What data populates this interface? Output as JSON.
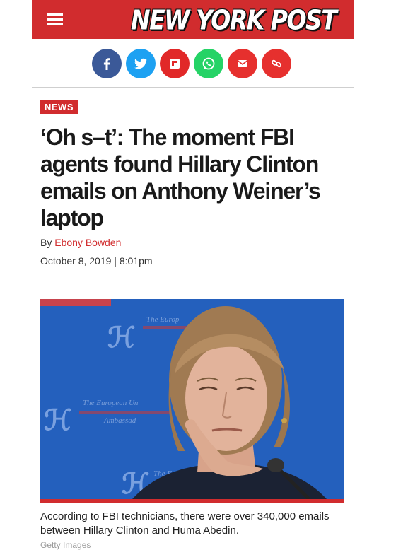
{
  "header": {
    "logo_text": "NEW YORK POST",
    "menu_icon": "hamburger-menu-icon",
    "brand_color": "#d12c2e"
  },
  "share": {
    "buttons": [
      {
        "name": "facebook",
        "icon": "facebook-icon",
        "color": "#3b5998"
      },
      {
        "name": "twitter",
        "icon": "twitter-icon",
        "color": "#1da1f2"
      },
      {
        "name": "flipboard",
        "icon": "flipboard-icon",
        "color": "#e12828"
      },
      {
        "name": "whatsapp",
        "icon": "whatsapp-icon",
        "color": "#25d366"
      },
      {
        "name": "email",
        "icon": "email-icon",
        "color": "#e6302e"
      },
      {
        "name": "copy-link",
        "icon": "link-icon",
        "color": "#e6302e"
      }
    ]
  },
  "article": {
    "section_tag": "NEWS",
    "headline": "‘Oh s–t’: The moment FBI agents found Hillary Clinton emails on Anthony Weiner’s laptop",
    "byline_prefix": "By",
    "author": "Ebony Bowden",
    "date": "October 8, 2019 | 8:01pm"
  },
  "photo": {
    "caption": "According to FBI technicians, there were over 340,000 emails between Hillary Clinton and Huma Abedin.",
    "credit": "Getty Images"
  }
}
